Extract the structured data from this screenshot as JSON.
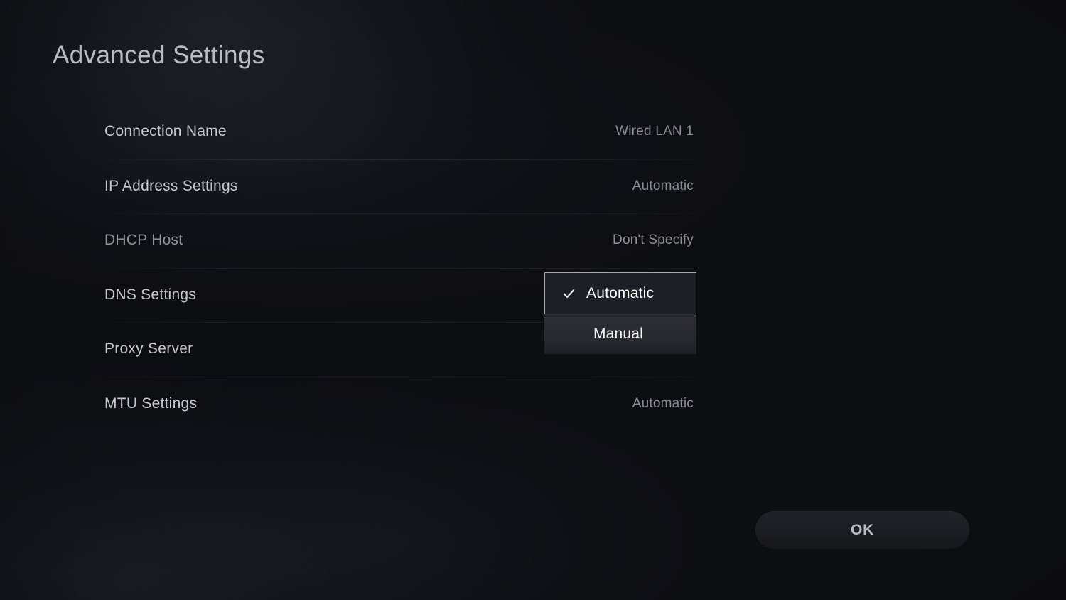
{
  "page": {
    "title": "Advanced Settings"
  },
  "settings": {
    "rows": [
      {
        "label": "Connection Name",
        "value": "Wired LAN 1",
        "dim": false,
        "value_hidden": false
      },
      {
        "label": "IP Address Settings",
        "value": "Automatic",
        "dim": false,
        "value_hidden": false
      },
      {
        "label": "DHCP Host",
        "value": "Don't Specify",
        "dim": true,
        "value_hidden": false
      },
      {
        "label": "DNS Settings",
        "value": "",
        "dim": false,
        "value_hidden": true
      },
      {
        "label": "Proxy Server",
        "value": "",
        "dim": false,
        "value_hidden": true
      },
      {
        "label": "MTU Settings",
        "value": "Automatic",
        "dim": false,
        "value_hidden": false
      }
    ]
  },
  "dropdown": {
    "owner_row": "DNS Settings",
    "options": [
      {
        "label": "Automatic",
        "selected": true,
        "icon": "check-icon"
      },
      {
        "label": "Manual",
        "selected": false,
        "icon": ""
      }
    ]
  },
  "footer": {
    "ok_label": "OK"
  },
  "colors": {
    "background": "#0d0e12",
    "title_text": "#b9bcc3",
    "label_text": "#c6c9d0",
    "label_text_dim": "#8f949e",
    "value_text": "#8c9099",
    "selection_border": "#aba8ae",
    "selection_fill": "#1d1f27",
    "option_fill": "#2e2f35",
    "option_text": "#f2f3f5",
    "ok_button_fill": "#1c1d22",
    "ok_button_text": "#b9bcc2"
  }
}
